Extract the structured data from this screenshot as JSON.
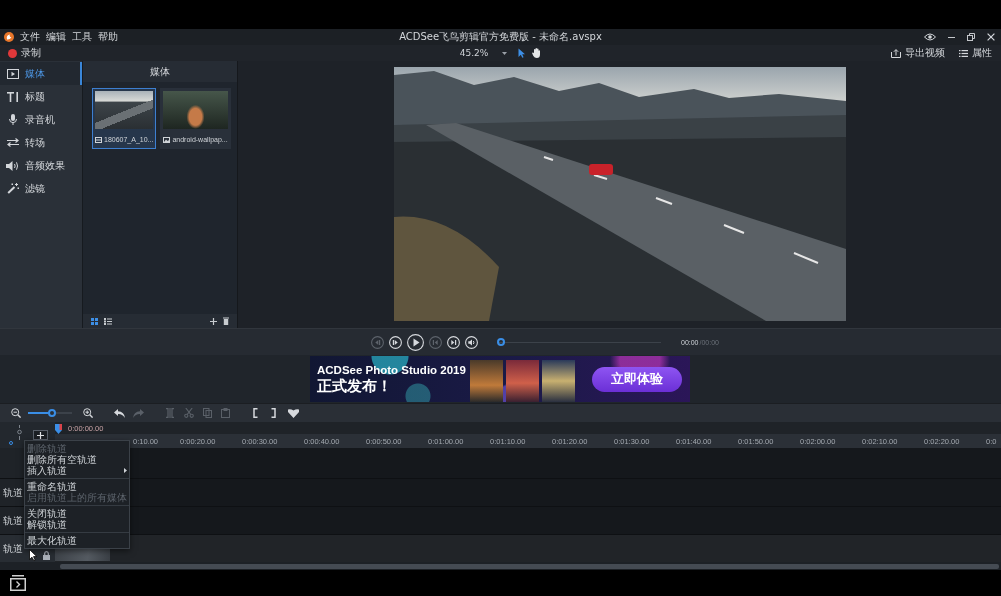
{
  "window": {
    "title": "ACDSee飞鸟剪辑官方免费版 - 未命名.avspx"
  },
  "menu_bar": [
    "文件",
    "编辑",
    "工具",
    "帮助"
  ],
  "toolbar": {
    "record": "录制",
    "zoom": "45.2%",
    "tools": [
      {
        "kind": "pointer",
        "selected": true
      },
      {
        "kind": "hand",
        "selected": false
      }
    ],
    "export": "导出视频",
    "properties": "属性"
  },
  "sidebar": {
    "items": [
      {
        "kind": "media",
        "label": "媒体",
        "selected": true
      },
      {
        "kind": "title",
        "label": "标题",
        "selected": false
      },
      {
        "kind": "recorder",
        "label": "录音机",
        "selected": false
      },
      {
        "kind": "transition",
        "label": "转场",
        "selected": false
      },
      {
        "kind": "audio",
        "label": "音频效果",
        "selected": false
      },
      {
        "kind": "filter",
        "label": "滤镜",
        "selected": false
      }
    ]
  },
  "media_panel": {
    "title": "媒体",
    "items": [
      {
        "kind": "video",
        "name": "180607_A_10...",
        "selected": true
      },
      {
        "kind": "image",
        "name": "android-wallpap...",
        "selected": false
      }
    ],
    "views": [
      {
        "kind": "grid",
        "selected": true
      },
      {
        "kind": "list",
        "selected": false
      }
    ]
  },
  "player": {
    "controls": [
      {
        "kind": "previous",
        "disabled": true
      },
      {
        "kind": "step_forward",
        "disabled": false
      },
      {
        "kind": "play",
        "disabled": false
      },
      {
        "kind": "to_start",
        "disabled": true
      },
      {
        "kind": "to_end",
        "disabled": false
      },
      {
        "kind": "volume",
        "disabled": false
      }
    ],
    "seek": {
      "level": 0
    },
    "time": "00:00",
    "duration": "/00:00"
  },
  "ad_banner": {
    "headline": "ACDSee Photo Studio 2019",
    "subline": "正式发布！",
    "button": "立即体验"
  },
  "timeline": {
    "zoom": {
      "level": 0.55
    },
    "tools": [
      {
        "kind": "undo",
        "disabled": false
      },
      {
        "kind": "redo",
        "disabled": true
      },
      {
        "kind": "split",
        "disabled": true
      },
      {
        "kind": "cut",
        "disabled": true
      },
      {
        "kind": "copy",
        "disabled": true
      },
      {
        "kind": "paste",
        "disabled": true
      },
      {
        "kind": "mark_in",
        "disabled": false
      },
      {
        "kind": "mark_out",
        "disabled": false
      },
      {
        "kind": "marker",
        "disabled": false
      }
    ],
    "playhead": "0:00:00.00",
    "ruler": [
      "0:10.00",
      "0:00:20.00",
      "0:00:30.00",
      "0:00:40.00",
      "0:00:50.00",
      "0:01:00.00",
      "0:01:10.00",
      "0:01:20.00",
      "0:01:30.00",
      "0:01:40.00",
      "0:01:50.00",
      "0:02:00.00",
      "0:02:10.00",
      "0:02:20.00",
      "0:0"
    ],
    "tracks": [
      {
        "label": "轨道",
        "selected": false,
        "locked": false,
        "clip": false
      },
      {
        "label": "轨道",
        "selected": false,
        "locked": false,
        "clip": false
      },
      {
        "label": "轨道",
        "selected": true,
        "locked": true,
        "clip": true
      }
    ]
  },
  "context_menu": {
    "items": [
      {
        "kind": "item",
        "label": "删除轨道",
        "disabled": true,
        "submenu": false
      },
      {
        "kind": "item",
        "label": "删除所有空轨道",
        "disabled": false,
        "submenu": false
      },
      {
        "kind": "item",
        "label": "插入轨道",
        "disabled": false,
        "submenu": true
      },
      {
        "kind": "separator"
      },
      {
        "kind": "item",
        "label": "重命名轨道",
        "disabled": false,
        "submenu": false
      },
      {
        "kind": "item",
        "label": "启用轨道上的所有媒体",
        "disabled": true,
        "submenu": false
      },
      {
        "kind": "separator"
      },
      {
        "kind": "item",
        "label": "关闭轨道",
        "disabled": false,
        "submenu": false
      },
      {
        "kind": "item",
        "label": "解锁轨道",
        "disabled": false,
        "submenu": false
      },
      {
        "kind": "separator"
      },
      {
        "kind": "item",
        "label": "最大化轨道",
        "disabled": false,
        "submenu": false
      }
    ]
  }
}
